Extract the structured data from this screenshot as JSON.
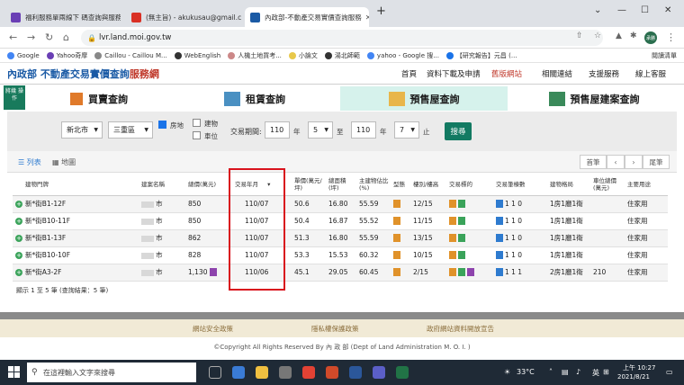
{
  "browser": {
    "tabs": [
      {
        "title": "福利服務單兩線下 碼查詢與服務",
        "color": "#6a3fb5"
      },
      {
        "title": "(無主旨) - akukusau@gmail.com",
        "color": "#d93025"
      },
      {
        "title": "內政部-不動產交易實價查詢服務",
        "color": "#1a5aa5"
      }
    ],
    "new_tab": "+",
    "url": "lvr.land.moi.gov.tw",
    "bookmarks": [
      "Google",
      "Yahoo奇摩",
      "Caillou - Caillou M...",
      "WebEnglish",
      "人機土地買考...",
      "小論文",
      "湯北師範",
      "yahoo - Google 搜...",
      "【研究報告】元昌 (..."
    ],
    "bookmark_more": "閱讀清單",
    "profile": "承勝"
  },
  "site": {
    "logo_main": "內政部 不動產交易實價查詢",
    "logo_accent": "服務網",
    "nav": [
      "首頁",
      "資料下載及申請",
      "舊版網站",
      "相關連結",
      "支援服務",
      "線上客服"
    ],
    "side_icon": "將幾 操作",
    "categories": [
      "買賣查詢",
      "租賃查詢",
      "預售屋查詢",
      "預售屋建案查詢"
    ]
  },
  "search": {
    "city": "新北市",
    "district": "三重區",
    "opt_land": "房地",
    "opt_building": "建物",
    "opt_parking": "車位",
    "period_label": "交易期間:",
    "from_year": "110",
    "from_month": "5",
    "to_year": "110",
    "to_month": "7",
    "year_unit": "年",
    "to_label": "至",
    "until_label": "止",
    "button": "搜尋"
  },
  "listbar": {
    "list": "列表",
    "map": "地圖",
    "first": "首筆",
    "prev": "‹",
    "next": "›",
    "last": "尾筆"
  },
  "table": {
    "headers": [
      "建物門牌",
      "建案名稱",
      "總價(萬元)",
      "交易年月",
      "單價(萬元/坪)",
      "總面積(坪)",
      "主建物佔比(%)",
      "型態",
      "樓別/樓高",
      "交易標的",
      "交易筆棟數",
      "建物格局",
      "車位總價(萬元)",
      "主要用途"
    ],
    "rows": [
      {
        "addr": "新*街B1-12F",
        "proj": "市",
        "price": "850",
        "ym": "110/07",
        "unit": "50.6",
        "area": "16.80",
        "ratio": "55.59",
        "floor": "12/15",
        "count": "1 1 0",
        "layout": "1房1廳1衛",
        "park": "",
        "use": "住家用"
      },
      {
        "addr": "新*街B10-11F",
        "proj": "市",
        "price": "850",
        "ym": "110/07",
        "unit": "50.4",
        "area": "16.87",
        "ratio": "55.52",
        "floor": "11/15",
        "count": "1 1 0",
        "layout": "1房1廳1衛",
        "park": "",
        "use": "住家用"
      },
      {
        "addr": "新*街B1-13F",
        "proj": "市",
        "price": "862",
        "ym": "110/07",
        "unit": "51.3",
        "area": "16.80",
        "ratio": "55.59",
        "floor": "13/15",
        "count": "1 1 0",
        "layout": "1房1廳1衛",
        "park": "",
        "use": "住家用"
      },
      {
        "addr": "新*街B10-10F",
        "proj": "市",
        "price": "828",
        "ym": "110/07",
        "unit": "53.3",
        "area": "15.53",
        "ratio": "60.32",
        "floor": "10/15",
        "count": "1 1 0",
        "layout": "1房1廳1衛",
        "park": "",
        "use": "住家用"
      },
      {
        "addr": "新*街A3-2F",
        "proj": "市",
        "price": "1,130",
        "ym": "110/06",
        "unit": "45.1",
        "area": "29.05",
        "ratio": "60.45",
        "floor": "2/15",
        "count": "1 1 1",
        "layout": "2房1廳1衛",
        "park": "210",
        "use": "住家用"
      }
    ],
    "footnote": "顯示 1 至 5 筆 (查詢結果：5 筆)"
  },
  "footer": {
    "links": [
      "網站安全政策",
      "隱私權保護政策",
      "政府網站資料開放宣告"
    ],
    "copyright": "©Copyright All Rights Reserved By 內 政 部 (Dept of Land Administration M. O. I. )"
  },
  "taskbar": {
    "search_placeholder": "在這裡輸入文字來搜尋",
    "temp": "33°C",
    "lang": "英",
    "time": "上午 10:27",
    "date": "2021/8/21"
  }
}
